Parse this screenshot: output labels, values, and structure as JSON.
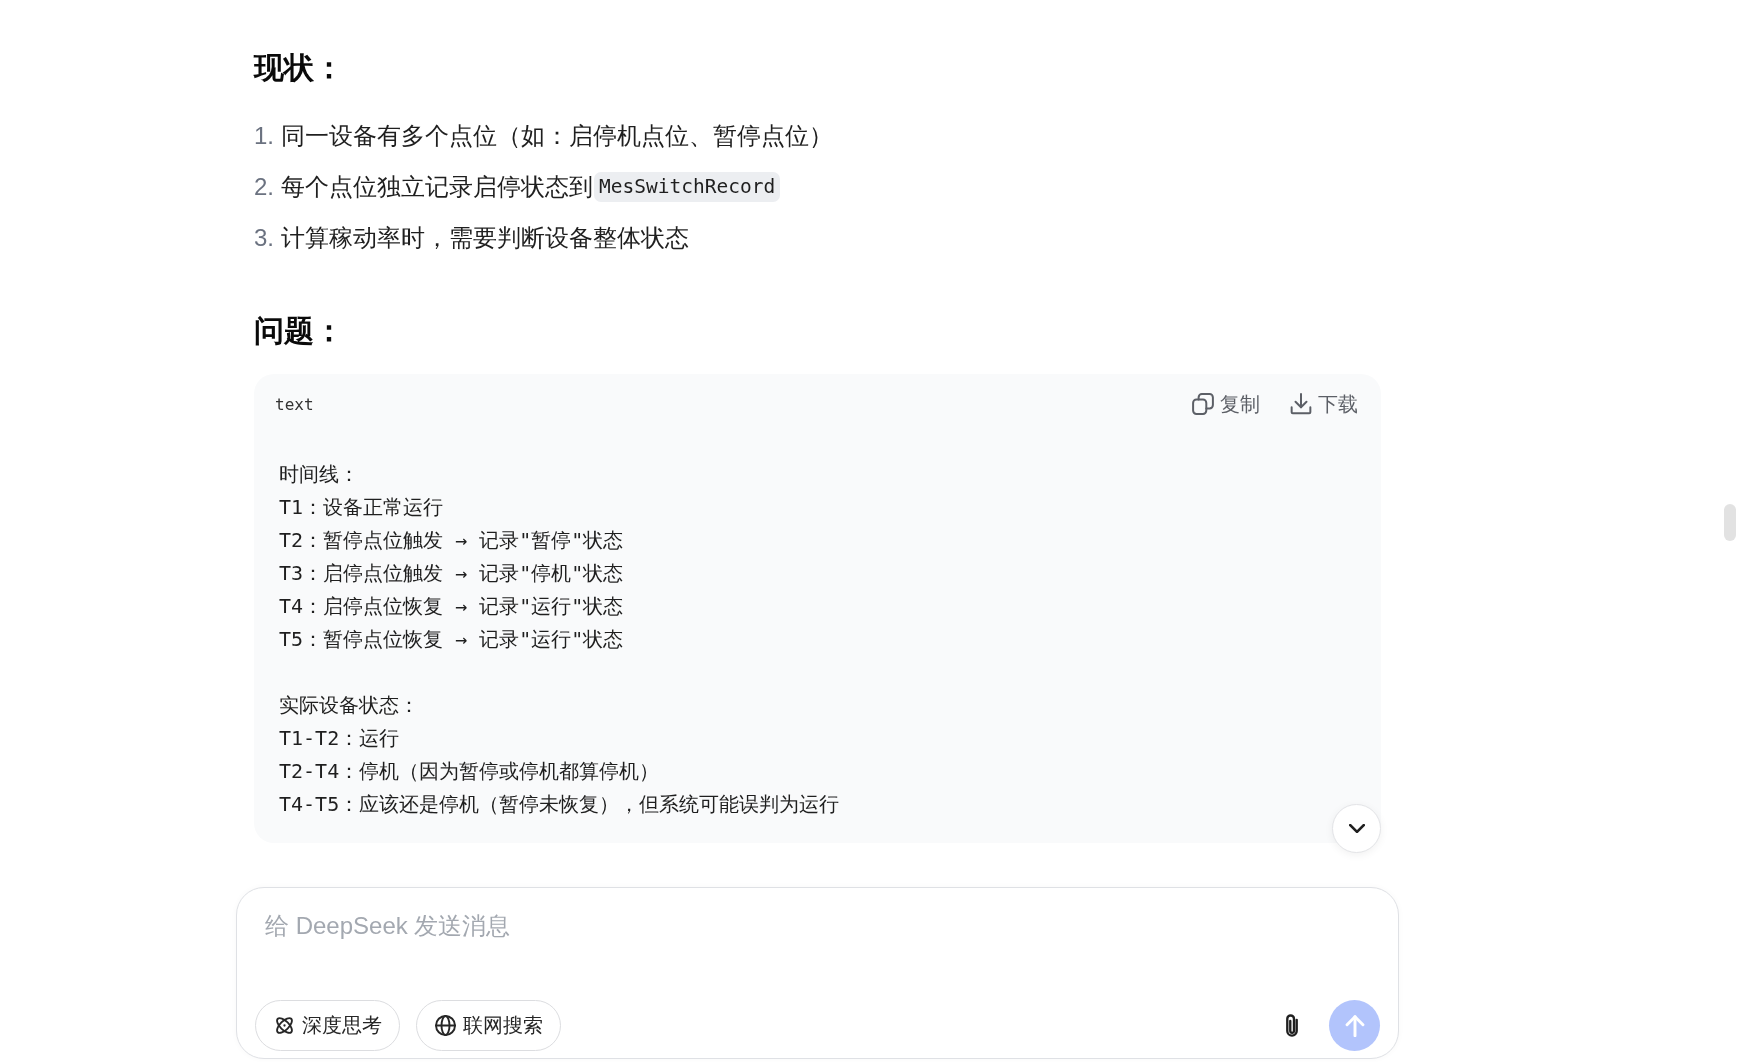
{
  "sections": [
    {
      "heading": "现状：",
      "list": [
        {
          "number": "1.",
          "text": "同一设备有多个点位（如：启停机点位、暂停点位）"
        },
        {
          "number": "2.",
          "text": "每个点位独立记录启停状态到",
          "code": "MesSwitchRecord"
        },
        {
          "number": "3.",
          "text": "计算稼动率时，需要判断设备整体状态"
        }
      ]
    },
    {
      "heading": "问题：",
      "code_block": {
        "language": "text",
        "actions": [
          {
            "kind": "copy",
            "label": "复制"
          },
          {
            "kind": "download",
            "label": "下载"
          }
        ],
        "paragraphs": [
          [
            "时间线：",
            "T1：设备正常运行",
            "T2：暂停点位触发 → 记录\"暂停\"状态",
            "T3：启停点位触发 → 记录\"停机\"状态",
            "T4：启停点位恢复 → 记录\"运行\"状态",
            "T5：暂停点位恢复 → 记录\"运行\"状态"
          ],
          [
            "实际设备状态：",
            "T1-T2：运行",
            "T2-T4：停机（因为暂停或停机都算停机）",
            "T4-T5：应该还是停机（暂停未恢复），但系统可能误判为运行"
          ]
        ]
      }
    }
  ],
  "composer": {
    "placeholder": "给 DeepSeek 发送消息",
    "toggles": [
      {
        "kind": "think",
        "label": "深度思考",
        "on": false
      },
      {
        "kind": "search",
        "label": "联网搜索",
        "on": false
      }
    ],
    "send": {
      "disabled": true
    }
  }
}
